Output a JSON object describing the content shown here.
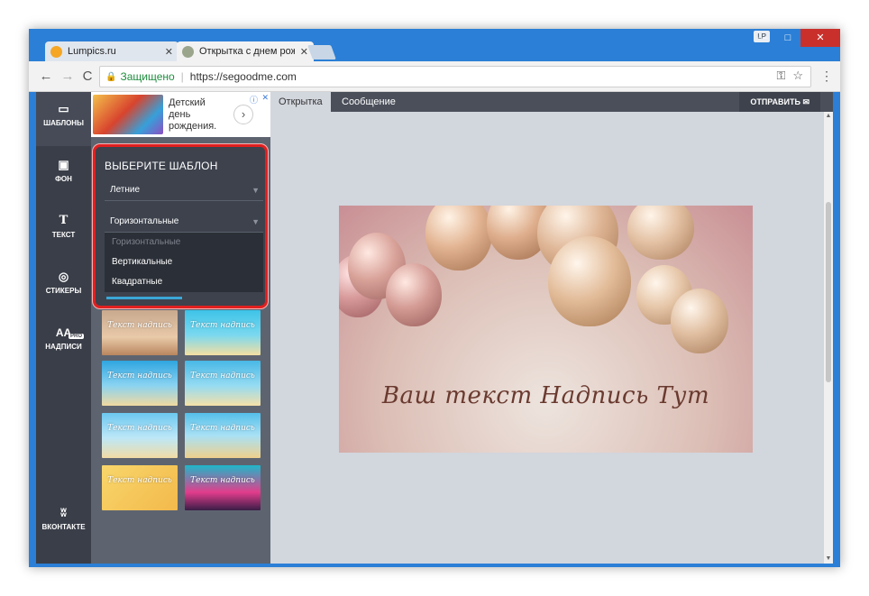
{
  "browser": {
    "tabs": [
      {
        "label": "Lumpics.ru",
        "favicon_color": "#f5a623"
      },
      {
        "label": "Открытка с днем рожде",
        "favicon_color": "#9aa58b"
      }
    ],
    "profile": "LP",
    "window_controls": {
      "minimize": "—",
      "maximize": "□",
      "close": "✕"
    },
    "nav": {
      "back": "←",
      "forward": "→",
      "reload": "C"
    },
    "secure_label": "Защищено",
    "url": "https://segoodme.com"
  },
  "rail": {
    "items": [
      {
        "label": "ШАБЛОНЫ",
        "icon": "template-icon"
      },
      {
        "label": "ФОН",
        "icon": "background-icon"
      },
      {
        "label": "ТЕКСТ",
        "icon": "text-icon"
      },
      {
        "label": "СТИКЕРЫ",
        "icon": "sticker-icon"
      },
      {
        "label": "НАДПИСИ",
        "icon": "inscriptions-icon",
        "badge": "PRO"
      },
      {
        "label": "ВКОНТАКТЕ",
        "icon": "vk-icon"
      }
    ]
  },
  "ad": {
    "text": "Детский день рождения.",
    "arrow": "›"
  },
  "selector": {
    "title": "ВЫБЕРИТЕ ШАБЛОН",
    "category_value": "Летние",
    "orientation_value": "Горизонтальные",
    "options": [
      "Горизонтальные",
      "Вертикальные",
      "Квадратные"
    ]
  },
  "thumbnails": [
    {
      "caption": "Текст надпись"
    },
    {
      "caption": "Текст надпись"
    },
    {
      "caption": "Текст надпись"
    },
    {
      "caption": "Текст надпись"
    },
    {
      "caption": "Текст надпись"
    },
    {
      "caption": "Текст надпись"
    },
    {
      "caption": "Текст надпись"
    },
    {
      "caption": "Текст надпись"
    }
  ],
  "content_tabs": [
    "Открытка",
    "Сообщение"
  ],
  "send_label": "ОТПРАВИТЬ ✉",
  "card": {
    "text": "Ваш текст Надпись Тут"
  },
  "colors": {
    "accent": "#3ba7d6",
    "highlight": "#e02020",
    "rail": "#3a3e48"
  }
}
